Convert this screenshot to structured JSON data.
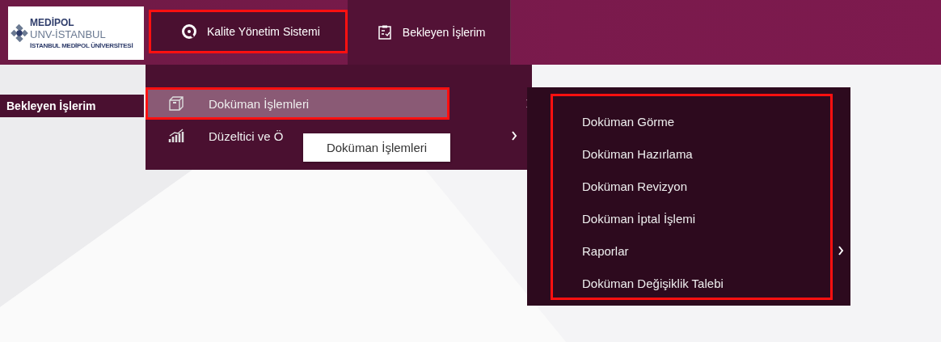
{
  "logo": {
    "lines": [
      "MEDİPOL",
      "UNV-İSTANBUL",
      "İSTANBUL MEDİPOL ÜNİVERSİTESİ"
    ]
  },
  "nav": [
    {
      "label": "Kalite Yönetim Sistemi",
      "kind": "quality",
      "highlighted": true
    },
    {
      "label": "Bekleyen İşlerim",
      "kind": "tasks",
      "highlighted": false
    }
  ],
  "sidebar": {
    "title": "Bekleyen İşlerim"
  },
  "menu": {
    "items": [
      {
        "label": "Doküman İşlemleri",
        "kind": "documents",
        "selected": true,
        "highlighted": true,
        "has_submenu": true
      },
      {
        "label": "Düzeltici ve Ö",
        "kind": "improvement",
        "selected": false,
        "highlighted": false,
        "has_submenu": true
      }
    ],
    "tooltip": "Doküman İşlemleri"
  },
  "submenu": {
    "highlighted": true,
    "items": [
      {
        "label": "Doküman Görme",
        "has_submenu": false
      },
      {
        "label": "Doküman Hazırlama",
        "has_submenu": false
      },
      {
        "label": "Doküman Revizyon",
        "has_submenu": false
      },
      {
        "label": "Doküman İptal İşlemi",
        "has_submenu": false
      },
      {
        "label": "Raporlar",
        "has_submenu": true
      },
      {
        "label": "Doküman Değişiklik Talebi",
        "has_submenu": false
      }
    ]
  }
}
